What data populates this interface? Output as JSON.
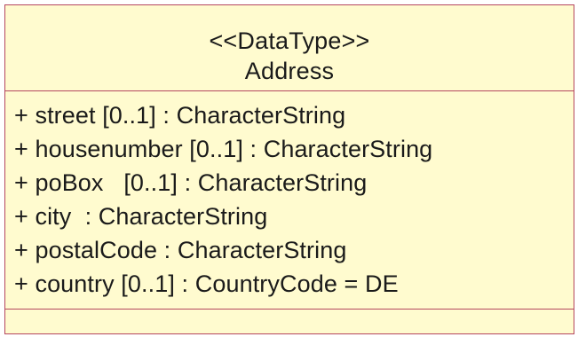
{
  "class": {
    "stereotype": "<<DataType>>",
    "name": "Address",
    "attributes": [
      "+ street [0..1] : CharacterString",
      "+ housenumber [0..1] : CharacterString",
      "+ poBox   [0..1] : CharacterString",
      "+ city  : CharacterString",
      "+ postalCode : CharacterString",
      "+ country [0..1] : CountryCode = DE"
    ]
  },
  "colors": {
    "fill": "#fffbcf",
    "border": "#b5475f",
    "text": "#1a1a1a"
  }
}
